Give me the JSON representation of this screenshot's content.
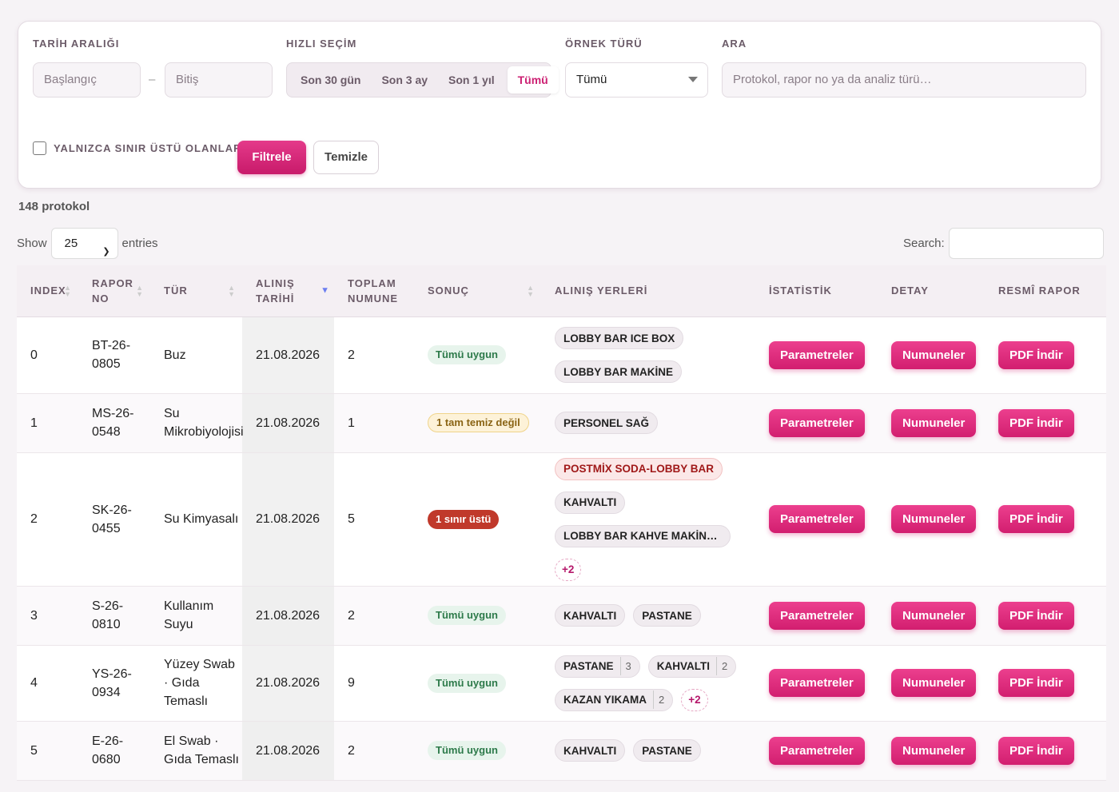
{
  "filters": {
    "date_range_label": "TARİH ARALIĞI",
    "start_placeholder": "Başlangıç",
    "end_placeholder": "Bitiş",
    "dash": "–",
    "quick_label": "HIZLI SEÇİM",
    "quick_options": [
      "Son 30 gün",
      "Son 3 ay",
      "Son 1 yıl",
      "Tümü"
    ],
    "quick_active": "Tümü",
    "sample_type_label": "ÖRNEK TÜRÜ",
    "sample_type_value": "Tümü",
    "search_label": "ARA",
    "search_placeholder": "Protokol, rapor no ya da analiz türü…",
    "only_over_limit_label": "YALNIZCA SINIR ÜSTÜ OLANLAR",
    "filter_button": "Filtrele",
    "clear_button": "Temizle"
  },
  "count_text": "148 protokol",
  "datatable": {
    "show_label": "Show",
    "page_size": "25",
    "entries_label": "entries",
    "search_label": "Search:"
  },
  "columns": {
    "index": "INDEX",
    "report_no": "RAPOR NO",
    "type": "TÜR",
    "date": "ALINIŞ TARİHİ",
    "total": "TOPLAM NUMUNE",
    "result": "SONUÇ",
    "locations": "ALINIŞ YERLERİ",
    "stats": "İSTATİSTİK",
    "detail": "DETAY",
    "official": "RESMÎ RAPOR"
  },
  "buttons": {
    "params": "Parametreler",
    "samples": "Numuneler",
    "pdf": "PDF İndir"
  },
  "rows": [
    {
      "index": "0",
      "report_no": "BT-26-0805",
      "type": "Buz",
      "date": "21.08.2026",
      "total": "2",
      "result": "Tümü uygun",
      "result_kind": "ok",
      "locations": [
        {
          "name": "LOBBY BAR ICE BOX"
        },
        {
          "name": "LOBBY BAR MAKİNE"
        }
      ]
    },
    {
      "index": "1",
      "report_no": "MS-26-0548",
      "type": "Su Mikrobiyolojisi",
      "date": "21.08.2026",
      "total": "1",
      "result": "1 tam temiz değil",
      "result_kind": "warn",
      "locations": [
        {
          "name": "PERSONEL SAĞ"
        }
      ]
    },
    {
      "index": "2",
      "report_no": "SK-26-0455",
      "type": "Su Kimyasalı",
      "date": "21.08.2026",
      "total": "5",
      "result": "1 sınır üstü",
      "result_kind": "bad",
      "locations": [
        {
          "name": "POSTMİX SODA-LOBBY BAR"
        },
        {
          "name": "KAHVALTI"
        },
        {
          "name": "LOBBY BAR KAHVE MAKİNESİ"
        }
      ],
      "more": "+2"
    },
    {
      "index": "3",
      "report_no": "S-26-0810",
      "type": "Kullanım Suyu",
      "date": "21.08.2026",
      "total": "2",
      "result": "Tümü uygun",
      "result_kind": "ok",
      "locations": [
        {
          "name": "KAHVALTI"
        },
        {
          "name": "PASTANE"
        }
      ]
    },
    {
      "index": "4",
      "report_no": "YS-26-0934",
      "type": "Yüzey Swab · Gıda Temaslı",
      "date": "21.08.2026",
      "total": "9",
      "result": "Tümü uygun",
      "result_kind": "ok",
      "locations": [
        {
          "name": "PASTANE",
          "count": "3"
        },
        {
          "name": "KAHVALTI",
          "count": "2"
        },
        {
          "name": "KAZAN YIKAMA",
          "count": "2"
        }
      ],
      "more": "+2"
    },
    {
      "index": "5",
      "report_no": "E-26-0680",
      "type": "El Swab · Gıda Temaslı",
      "date": "21.08.2026",
      "total": "2",
      "result": "Tümü uygun",
      "result_kind": "ok",
      "locations": [
        {
          "name": "KAHVALTI"
        },
        {
          "name": "PASTANE"
        }
      ]
    }
  ],
  "colors": {
    "accent": "#d21e6f",
    "ok_bg": "#e7f4ec",
    "warn_bg": "#fdf2d8",
    "bad_bg": "#c0392b"
  }
}
